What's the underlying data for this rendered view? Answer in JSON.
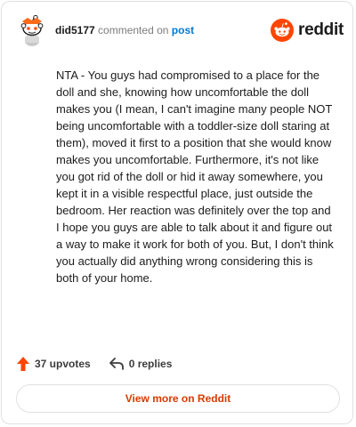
{
  "header": {
    "username": "did5177",
    "commented_text": "commented on",
    "post_link": "post",
    "brand_text": "reddit"
  },
  "comment": {
    "body": "NTA - You guys had compromised to a place for the doll and she, knowing how uncomfortable the doll makes you (I mean, I can't imagine many people NOT being uncomfortable with a toddler-size doll staring at them), moved it first to a position that she would know makes you uncomfortable. Furthermore, it's not like you got rid of the doll or hid it away somewhere, you kept it in a visible respectful place, just outside the bedroom. Her reaction was definitely over the top and I hope you guys are able to talk about it and figure out a way to make it work for both of you. But, I don't think you actually did anything wrong considering this is both of your home."
  },
  "actions": {
    "upvotes": "37 upvotes",
    "replies": "0 replies"
  },
  "footer": {
    "view_more": "View more on Reddit"
  },
  "icons": {
    "avatar": "snoo-avatar-icon",
    "brand": "reddit-logo-icon",
    "upvote": "upvote-arrow-icon",
    "reply": "reply-arrow-icon"
  },
  "colors": {
    "reddit_orange": "#ff4500",
    "link_blue": "#0079d3",
    "view_more_text": "#d93a00"
  }
}
